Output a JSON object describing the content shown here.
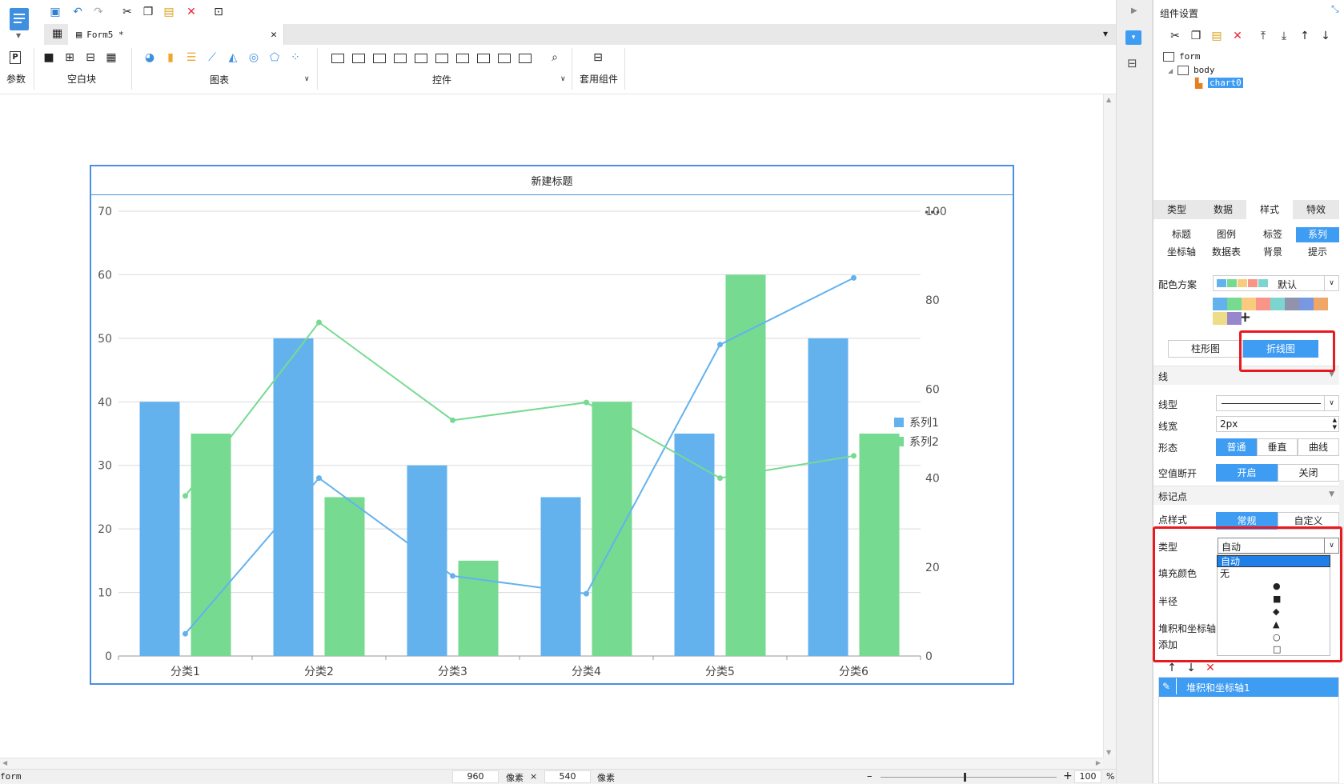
{
  "app": {
    "doc_tab": "Form5 *",
    "ribbon": {
      "params_label": "参数",
      "blank_label": "空白块",
      "chart_label": "图表",
      "controls_label": "控件",
      "template_label": "套用组件"
    }
  },
  "status_bar": {
    "left_label": "form",
    "width_value": "960",
    "width_unit": "像素",
    "times": "×",
    "height_value": "540",
    "height_unit": "像素",
    "zoom_minus": "–",
    "zoom_plus": "+",
    "zoom_value": "100",
    "zoom_unit": "%"
  },
  "right_panel": {
    "title": "组件设置",
    "tree": {
      "root": "form",
      "body": "body",
      "selected": "chart0"
    },
    "tabs": [
      "类型",
      "数据",
      "样式",
      "特效"
    ],
    "active_tab": "样式",
    "sub_tabs_row1": [
      "标题",
      "图例",
      "标签",
      "系列"
    ],
    "sub_tabs_row2": [
      "坐标轴",
      "数据表",
      "背景",
      "提示"
    ],
    "active_sub_tab": "系列",
    "color_scheme_label": "配色方案",
    "color_scheme_value": "默认",
    "palette": [
      "#63b2ee",
      "#76da91",
      "#f8cb7f",
      "#f89588",
      "#7cd6cf",
      "#9192ab",
      "#7898e1",
      "#efa666",
      "#eddd86",
      "#9987ce"
    ],
    "add_glyph": "+",
    "chart_type_bar": "柱形图",
    "chart_type_line": "折线图",
    "section_line": "线",
    "line_type_label": "线型",
    "line_width_label": "线宽",
    "line_width_value": "2px",
    "shape_label": "形态",
    "shape_options": [
      "普通",
      "垂直",
      "曲线"
    ],
    "gap_label": "空值断开",
    "gap_options": [
      "开启",
      "关闭"
    ],
    "section_marker": "标记点",
    "point_style_label": "点样式",
    "point_style_options": [
      "常规",
      "自定义"
    ],
    "marker_type_label": "类型",
    "marker_type_value": "自动",
    "fill_color_label": "填充颜色",
    "radius_label": "半径",
    "stack_label": "堆积和坐标轴",
    "add_label": "添加",
    "dropdown_options": [
      "自动",
      "无"
    ],
    "dropdown_glyphs": [
      "●",
      "■",
      "◆",
      "▲",
      "○",
      "□"
    ],
    "stack_item": "堆积和坐标轴1"
  },
  "chart_data": {
    "type": "bar",
    "title": "新建标题",
    "categories": [
      "分类1",
      "分类2",
      "分类3",
      "分类4",
      "分类5",
      "分类6"
    ],
    "series": [
      {
        "name": "系列1",
        "kind": "bar",
        "axis": "left",
        "color": "#63b2ee",
        "values": [
          40,
          50,
          30,
          25,
          35,
          50
        ]
      },
      {
        "name": "系列2",
        "kind": "bar",
        "axis": "left",
        "color": "#76da91",
        "values": [
          35,
          25,
          15,
          40,
          60,
          35
        ]
      },
      {
        "kind": "line",
        "axis": "right",
        "color": "#63b2ee",
        "values": [
          5,
          40,
          18,
          14,
          70,
          85
        ]
      },
      {
        "kind": "line",
        "axis": "right",
        "color": "#76da91",
        "values": [
          36,
          75,
          53,
          57,
          40,
          45
        ]
      }
    ],
    "y_left": {
      "min": 0,
      "max": 70,
      "ticks": [
        0,
        10,
        20,
        30,
        40,
        50,
        60,
        70
      ]
    },
    "y_right": {
      "min": 0,
      "max": 100,
      "ticks": [
        0,
        20,
        40,
        60,
        80,
        100
      ]
    },
    "legend_position": "right",
    "grid": true,
    "more_glyph": "•••"
  }
}
